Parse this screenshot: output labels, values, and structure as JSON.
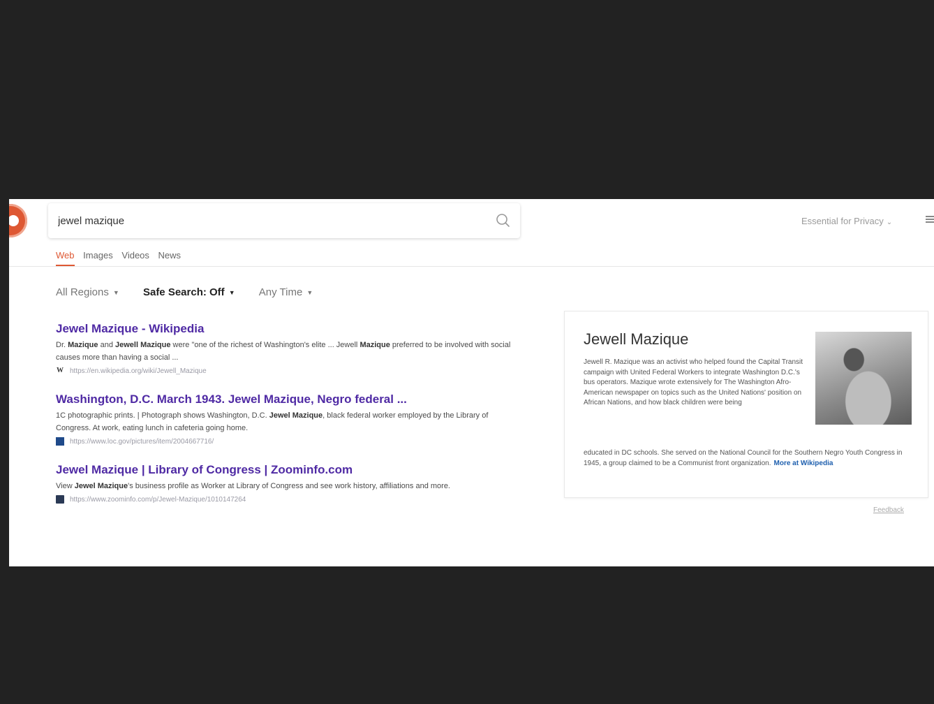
{
  "search": {
    "query": "jewel mazique"
  },
  "header": {
    "privacy_label": "Essential for Privacy"
  },
  "tabs": [
    {
      "label": "Web"
    },
    {
      "label": "Images"
    },
    {
      "label": "Videos"
    },
    {
      "label": "News"
    }
  ],
  "filters": [
    {
      "label": "All Regions"
    },
    {
      "label": "Safe Search: Off"
    },
    {
      "label": "Any Time"
    }
  ],
  "results": [
    {
      "title": "Jewel Mazique - Wikipedia",
      "snippet_pre": "Dr. ",
      "snippet_b1": "Mazique",
      "snippet_mid": " and ",
      "snippet_b2": "Jewell Mazique",
      "snippet_mid2": " were \"one of the richest of Washington's elite ... Jewell ",
      "snippet_b3": "Mazique",
      "snippet_post": " preferred to be involved with social causes more than having a social ...",
      "url": "https://en.wikipedia.org/wiki/Jewell_Mazique"
    },
    {
      "title": "Washington, D.C. March 1943. Jewel Mazique, Negro federal ...",
      "snippet_pre": "1C photographic prints. | Photograph shows Washington, D.C. ",
      "snippet_b1": "Jewel Mazique",
      "snippet_post": ", black federal worker employed by the Library of Congress. At work, eating lunch in cafeteria going home.",
      "url": "https://www.loc.gov/pictures/item/2004667716/"
    },
    {
      "title": "Jewel Mazique | Library of Congress | Zoominfo.com",
      "snippet_pre": "View ",
      "snippet_b1": "Jewel Mazique",
      "snippet_post": "'s business profile as Worker at Library of Congress and see work history, affiliations and more.",
      "url": "https://www.zoominfo.com/p/Jewel-Mazique/1010147264"
    }
  ],
  "panel": {
    "title": "Jewell Mazique",
    "text_narrow": "Jewell R. Mazique was an activist who helped found the Capital Transit campaign with United Federal Workers to integrate Washington D.C.'s bus operators. Mazique wrote extensively for The Washington Afro-American newspaper on topics such as the United Nations' position on African Nations, and how black children were being",
    "text_wide": "educated in DC schools. She served on the National Council for the Southern Negro Youth Congress in 1945, a group claimed to be a Communist front organization.",
    "more_link": "More at Wikipedia"
  },
  "feedback": "Feedback"
}
